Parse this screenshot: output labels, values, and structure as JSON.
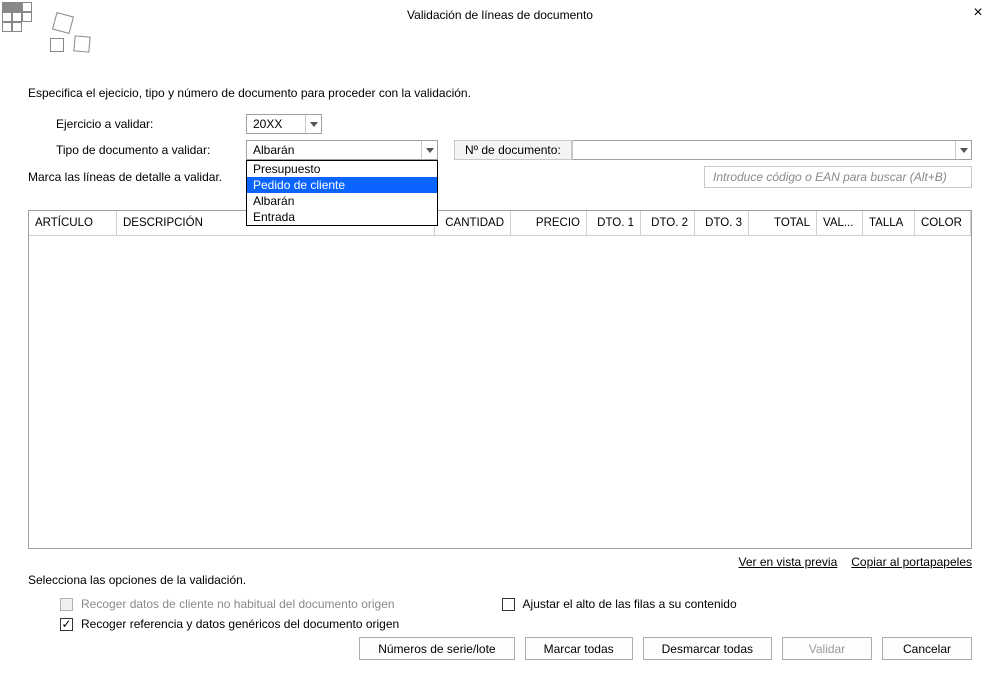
{
  "window": {
    "title": "Validación de líneas de documento",
    "close_icon": "×"
  },
  "instructions": {
    "line1": "Especifica el ejecicio, tipo y número de documento para proceder con la validación.",
    "line2": "Marca las líneas de detalle a validar.",
    "line3": "Selecciona las opciones de la validación."
  },
  "form": {
    "ejercicio_label": "Ejercicio a validar:",
    "ejercicio_value": "20XX",
    "tipodoc_label": "Tipo de documento a validar:",
    "tipodoc_value": "Albarán",
    "tipodoc_options": [
      "Presupuesto",
      "Pedido de cliente",
      "Albarán",
      "Entrada"
    ],
    "tipodoc_highlighted": "Pedido de cliente",
    "numdoc_label": "Nº de documento:",
    "numdoc_value": "",
    "search_placeholder": "Introduce código o EAN para buscar (Alt+B)"
  },
  "grid": {
    "columns": [
      "ARTÍCULO",
      "DESCRIPCIÓN",
      "CANTIDAD",
      "PRECIO",
      "DTO. 1",
      "DTO. 2",
      "DTO. 3",
      "TOTAL",
      "VAL...",
      "TALLA",
      "COLOR"
    ]
  },
  "links": {
    "preview": "Ver en vista previa",
    "copy": "Copiar al portapapeles"
  },
  "checkboxes": {
    "recoger_cliente": "Recoger datos de cliente no habitual del documento origen",
    "recoger_referencia": "Recoger referencia y datos genéricos del documento origen",
    "ajustar_alto": "Ajustar el alto de las filas a su contenido"
  },
  "buttons": {
    "serie": "Números de serie/lote",
    "marcar": "Marcar todas",
    "desmarcar": "Desmarcar todas",
    "validar": "Validar",
    "cancelar": "Cancelar"
  }
}
